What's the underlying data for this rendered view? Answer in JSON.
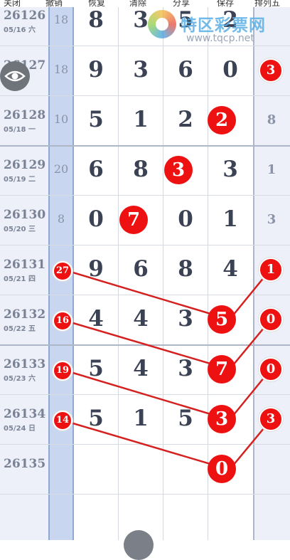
{
  "header": [
    "关闭",
    "撤销",
    "恢复",
    "清除",
    "分享",
    "保存",
    "排列五"
  ],
  "watermark": {
    "name": "特区彩票网",
    "url": "www.tqcp.net"
  },
  "rows": [
    {
      "period": "26126",
      "date": "05/16 六",
      "blue": "18",
      "d": [
        "8",
        "3",
        "5",
        "2"
      ],
      "r": ""
    },
    {
      "period": "26127",
      "date": "",
      "blue": "18",
      "d": [
        "9",
        "3",
        "6",
        "0"
      ],
      "r": "3"
    },
    {
      "period": "26128",
      "date": "05/18 一",
      "blue": "10",
      "d": [
        "5",
        "1",
        "2",
        "2"
      ],
      "r": "8"
    },
    {
      "period": "26129",
      "date": "05/19 二",
      "blue": "20",
      "d": [
        "6",
        "8",
        "3",
        "3"
      ],
      "r": "1"
    },
    {
      "period": "26130",
      "date": "05/20 三",
      "blue": "8",
      "d": [
        "0",
        "7",
        "0",
        "1"
      ],
      "r": "3"
    },
    {
      "period": "26131",
      "date": "05/21 四",
      "blue": "27",
      "d": [
        "9",
        "6",
        "8",
        "4"
      ],
      "r": "1"
    },
    {
      "period": "26132",
      "date": "05/22 五",
      "blue": "16",
      "d": [
        "4",
        "4",
        "3",
        "5"
      ],
      "r": "0"
    },
    {
      "period": "26133",
      "date": "05/23 六",
      "blue": "19",
      "d": [
        "5",
        "4",
        "3",
        "7"
      ],
      "r": "0"
    },
    {
      "period": "26134",
      "date": "05/24 日",
      "blue": "14",
      "d": [
        "5",
        "1",
        "5",
        "3"
      ],
      "r": "3"
    },
    {
      "period": "26135",
      "date": "",
      "blue": "",
      "d": [
        "",
        "",
        "",
        "0"
      ],
      "r": ""
    }
  ]
}
